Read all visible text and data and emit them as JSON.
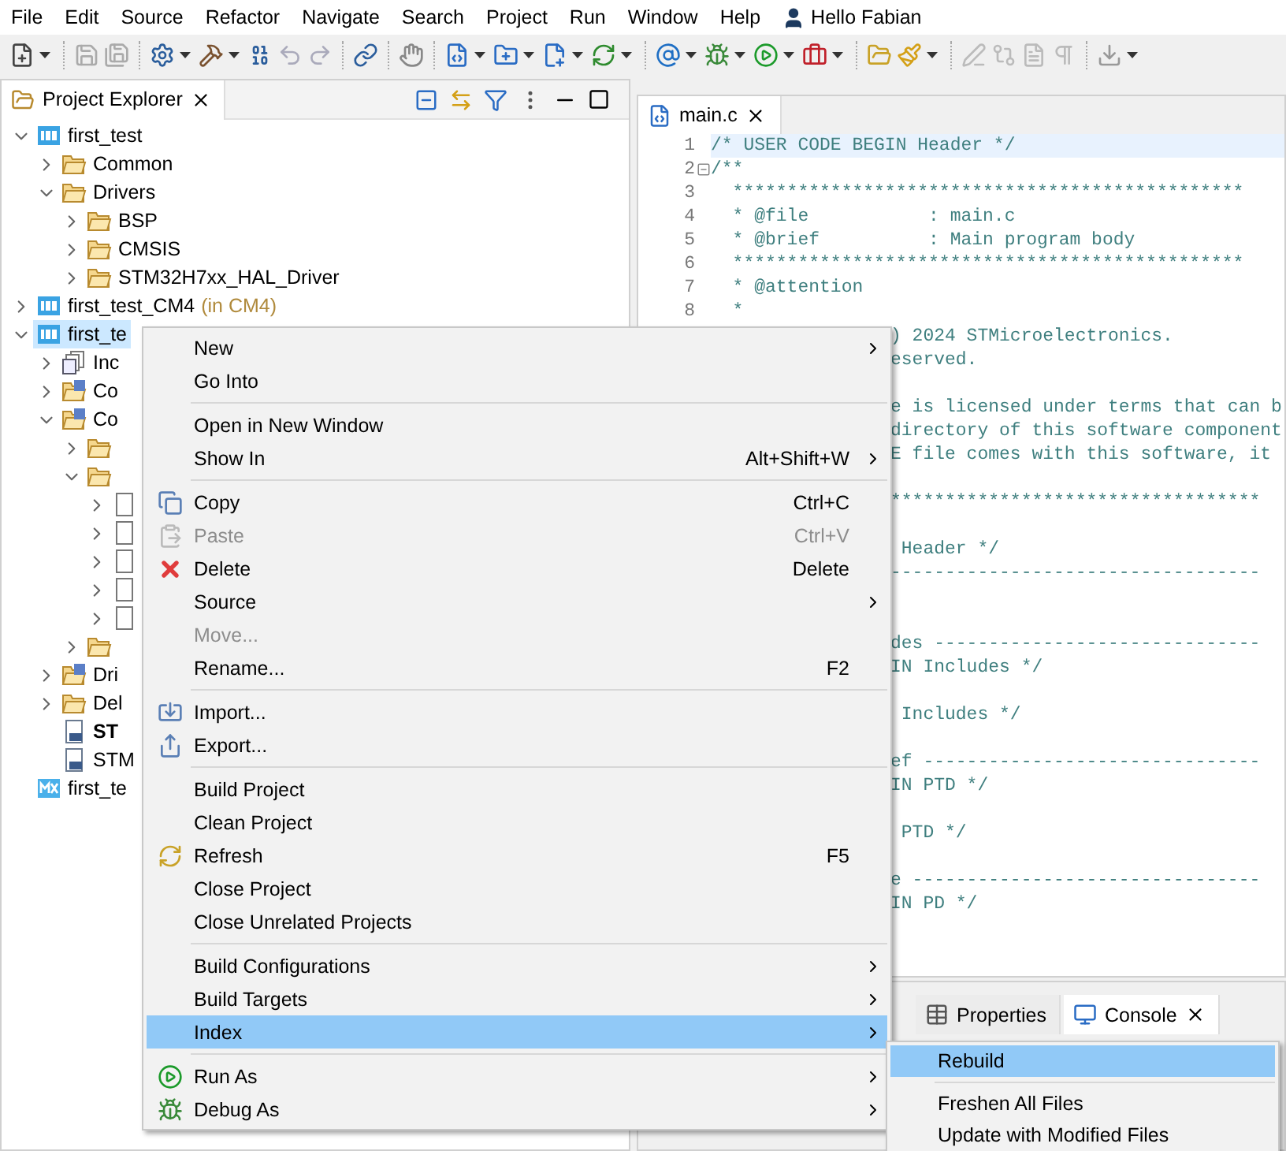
{
  "menu_bar": {
    "items": [
      "File",
      "Edit",
      "Source",
      "Refactor",
      "Navigate",
      "Search",
      "Project",
      "Run",
      "Window",
      "Help"
    ],
    "user": "Hello Fabian"
  },
  "project_explorer": {
    "title": "Project Explorer",
    "tree": [
      {
        "kind": "project",
        "label": "first_test",
        "expanded": true,
        "selected": false,
        "children": [
          {
            "kind": "folder",
            "label": "Common",
            "expanded": false,
            "selected": false
          },
          {
            "kind": "folder",
            "label": "Drivers",
            "expanded": true,
            "selected": false,
            "children": [
              {
                "kind": "folder",
                "label": "BSP",
                "expanded": false,
                "selected": false
              },
              {
                "kind": "folder",
                "label": "CMSIS",
                "expanded": false,
                "selected": false
              },
              {
                "kind": "folder",
                "label": "STM32H7xx_HAL_Driver",
                "expanded": false,
                "selected": false
              }
            ]
          }
        ]
      },
      {
        "kind": "project",
        "label": "first_test_CM4",
        "suffix": "(in CM4)",
        "expanded": false,
        "selected": false
      },
      {
        "kind": "project",
        "label": "first_te",
        "expanded": true,
        "selected": true,
        "children": [
          {
            "kind": "includes",
            "label": "Inc",
            "expanded": false,
            "selected": false
          },
          {
            "kind": "source-folder",
            "label": "Co",
            "expanded": false,
            "selected": false
          },
          {
            "kind": "source-folder",
            "label": "Co",
            "expanded": true,
            "selected": false,
            "children": [
              {
                "kind": "folder",
                "expanded": false,
                "selected": false
              },
              {
                "kind": "folder",
                "expanded": true,
                "selected": false,
                "children": [
                  {
                    "kind": "file",
                    "expanded": false,
                    "selected": false
                  },
                  {
                    "kind": "file",
                    "expanded": false,
                    "selected": false
                  },
                  {
                    "kind": "file",
                    "expanded": false,
                    "selected": false
                  },
                  {
                    "kind": "file",
                    "expanded": false,
                    "selected": false
                  },
                  {
                    "kind": "file",
                    "expanded": false,
                    "selected": false
                  }
                ]
              },
              {
                "kind": "folder",
                "expanded": false,
                "selected": false
              }
            ]
          },
          {
            "kind": "source-folder",
            "label": "Dri",
            "expanded": false,
            "selected": false
          },
          {
            "kind": "folder",
            "label": "Del",
            "expanded": false,
            "selected": false
          },
          {
            "kind": "linker",
            "label": "ST",
            "bold": true,
            "selected": false
          },
          {
            "kind": "linker",
            "label": "STM",
            "bold": false,
            "selected": false
          }
        ]
      },
      {
        "kind": "mx",
        "label": "first_te",
        "selected": false
      }
    ]
  },
  "editor": {
    "tab": "main.c",
    "lines": [
      {
        "number": "1",
        "text": "/* USER CODE BEGIN Header */",
        "current": true,
        "foldable": false
      },
      {
        "number": "2",
        "text": "/**",
        "current": false,
        "foldable": true
      },
      {
        "number": "3",
        "text": "  ***********************************************",
        "current": false,
        "foldable": false
      },
      {
        "number": "4",
        "text": "  * @file           : main.c",
        "current": false,
        "foldable": false
      },
      {
        "number": "5",
        "text": "  * @brief          : Main program body",
        "current": false,
        "foldable": false
      },
      {
        "number": "6",
        "text": "  ***********************************************",
        "current": false,
        "foldable": false
      },
      {
        "number": "7",
        "text": "  * @attention",
        "current": false,
        "foldable": false
      },
      {
        "number": "8",
        "text": "  *",
        "current": false,
        "foldable": false
      }
    ],
    "fragments": [
      {
        "kind": "text",
        "text": ") 2024 STMicroelectronics."
      },
      {
        "kind": "text",
        "text": "eserved."
      },
      {
        "kind": "blank"
      },
      {
        "kind": "text",
        "text": "e is licensed under terms that can b"
      },
      {
        "kind": "text",
        "text": "directory of this software component"
      },
      {
        "kind": "text",
        "text": "E file comes with this software, it"
      },
      {
        "kind": "blank"
      },
      {
        "kind": "text",
        "text": "**********************************"
      },
      {
        "kind": "blank"
      },
      {
        "kind": "text",
        "text": " Header */"
      },
      {
        "kind": "text",
        "text": "----------------------------------"
      },
      {
        "kind": "blank"
      },
      {
        "kind": "blank"
      },
      {
        "kind": "text",
        "text": "des ------------------------------"
      },
      {
        "kind": "text",
        "text": "IN Includes */"
      },
      {
        "kind": "blank"
      },
      {
        "kind": "text",
        "text": " Includes */"
      },
      {
        "kind": "blank"
      },
      {
        "kind": "text",
        "text": "ef -------------------------------"
      },
      {
        "kind": "text",
        "text": "IN PTD */"
      },
      {
        "kind": "blank"
      },
      {
        "kind": "text",
        "text": " PTD */"
      },
      {
        "kind": "blank"
      },
      {
        "kind": "text",
        "text": "e --------------------------------"
      },
      {
        "kind": "text",
        "text": "IN PD */"
      }
    ]
  },
  "bottom_panel": {
    "tabs": [
      {
        "label": "Properties",
        "selected": false,
        "closable": false
      },
      {
        "label": "Console",
        "selected": true,
        "closable": true
      }
    ]
  },
  "context_menu": {
    "items": [
      {
        "kind": "item",
        "label": "New",
        "submenu": true,
        "disabled": false,
        "selected": false
      },
      {
        "kind": "item",
        "label": "Go Into",
        "submenu": false,
        "disabled": false,
        "selected": false
      },
      {
        "kind": "separator"
      },
      {
        "kind": "item",
        "label": "Open in New Window",
        "submenu": false,
        "disabled": false,
        "selected": false
      },
      {
        "kind": "item",
        "label": "Show In",
        "shortcut": "Alt+Shift+W",
        "submenu": true,
        "disabled": false,
        "selected": false
      },
      {
        "kind": "separator"
      },
      {
        "kind": "item",
        "label": "Copy",
        "shortcut": "Ctrl+C",
        "submenu": false,
        "disabled": false,
        "selected": false
      },
      {
        "kind": "item",
        "label": "Paste",
        "shortcut": "Ctrl+V",
        "submenu": false,
        "disabled": true,
        "selected": false
      },
      {
        "kind": "item",
        "label": "Delete",
        "shortcut": "Delete",
        "submenu": false,
        "disabled": false,
        "selected": false
      },
      {
        "kind": "item",
        "label": "Source",
        "submenu": true,
        "disabled": false,
        "selected": false
      },
      {
        "kind": "item",
        "label": "Move...",
        "submenu": false,
        "disabled": true,
        "selected": false
      },
      {
        "kind": "item",
        "label": "Rename...",
        "shortcut": "F2",
        "submenu": false,
        "disabled": false,
        "selected": false
      },
      {
        "kind": "separator"
      },
      {
        "kind": "item",
        "label": "Import...",
        "submenu": false,
        "disabled": false,
        "selected": false
      },
      {
        "kind": "item",
        "label": "Export...",
        "submenu": false,
        "disabled": false,
        "selected": false
      },
      {
        "kind": "separator"
      },
      {
        "kind": "item",
        "label": "Build Project",
        "submenu": false,
        "disabled": false,
        "selected": false
      },
      {
        "kind": "item",
        "label": "Clean Project",
        "submenu": false,
        "disabled": false,
        "selected": false
      },
      {
        "kind": "item",
        "label": "Refresh",
        "shortcut": "F5",
        "submenu": false,
        "disabled": false,
        "selected": false
      },
      {
        "kind": "item",
        "label": "Close Project",
        "submenu": false,
        "disabled": false,
        "selected": false
      },
      {
        "kind": "item",
        "label": "Close Unrelated Projects",
        "submenu": false,
        "disabled": false,
        "selected": false
      },
      {
        "kind": "separator"
      },
      {
        "kind": "item",
        "label": "Build Configurations",
        "submenu": true,
        "disabled": false,
        "selected": false
      },
      {
        "kind": "item",
        "label": "Build Targets",
        "submenu": true,
        "disabled": false,
        "selected": false
      },
      {
        "kind": "item",
        "label": "Index",
        "submenu": true,
        "disabled": false,
        "selected": true
      },
      {
        "kind": "separator"
      },
      {
        "kind": "item",
        "label": "Run As",
        "submenu": true,
        "disabled": false,
        "selected": false
      },
      {
        "kind": "item",
        "label": "Debug As",
        "submenu": true,
        "disabled": false,
        "selected": false
      }
    ]
  },
  "index_submenu": {
    "items": [
      {
        "kind": "item",
        "label": "Rebuild",
        "submenu": false,
        "disabled": false,
        "selected": true
      },
      {
        "kind": "separator"
      },
      {
        "kind": "item",
        "label": "Freshen All Files",
        "submenu": false,
        "disabled": false,
        "selected": false
      },
      {
        "kind": "item",
        "label": "Update with Modified Files",
        "submenu": false,
        "disabled": false,
        "selected": false
      }
    ]
  }
}
